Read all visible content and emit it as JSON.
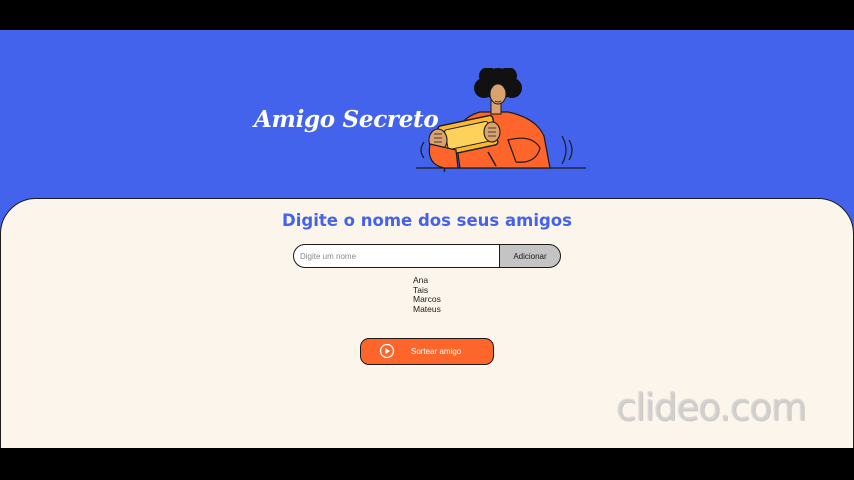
{
  "header": {
    "title": "Amigo Secreto"
  },
  "main": {
    "section_title": "Digite o nome dos seus amigos",
    "name_input": {
      "placeholder": "Digite um nome",
      "value": ""
    },
    "add_button_label": "Adicionar",
    "friends": [
      "Ana",
      "Tais",
      "Marcos",
      "Mateus"
    ],
    "draw_button": {
      "label": "Sortear amigo",
      "icon": "play-circle-icon"
    }
  },
  "watermark": {
    "text": "clideo.com"
  },
  "colors": {
    "header_bg": "#4463ED",
    "panel_bg": "#FCF5EB",
    "accent_title": "#4463ED",
    "draw_button_bg": "#FE652B",
    "add_button_bg": "#C4C4C4"
  }
}
